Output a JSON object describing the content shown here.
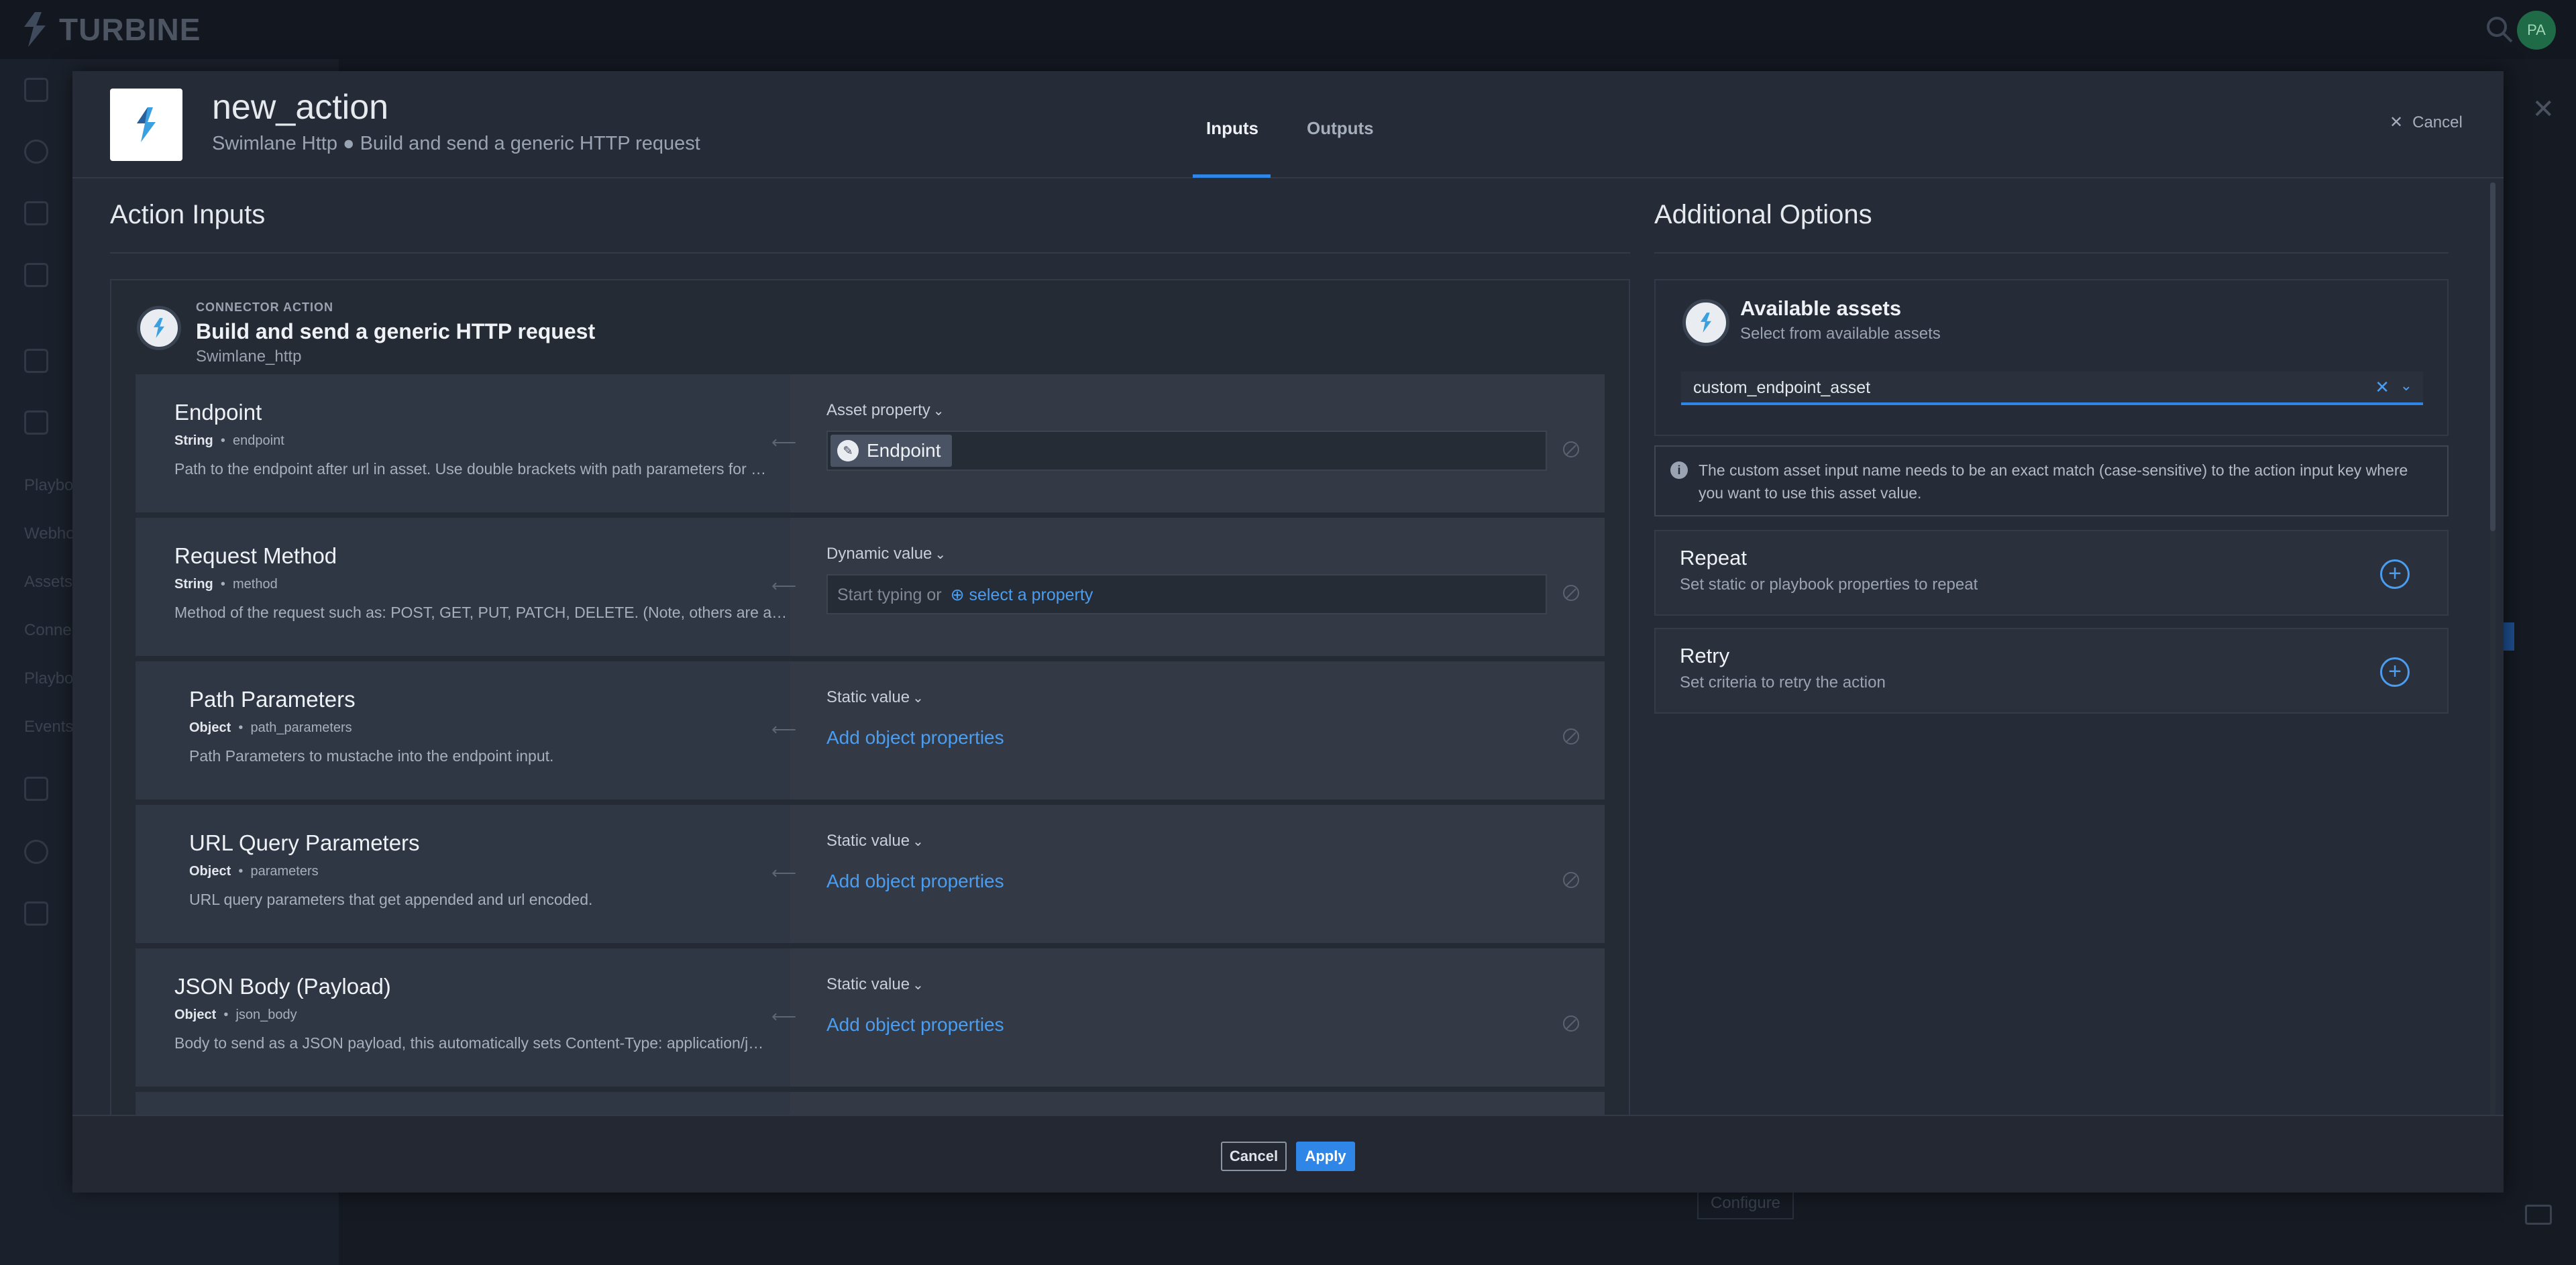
{
  "app": {
    "brand": "TURBINE",
    "avatar_initials": "PA"
  },
  "background_sidebar": {
    "items": [
      "Playbo",
      "Webho",
      "Assets",
      "Conne",
      "Playbo",
      "Events"
    ]
  },
  "background": {
    "configure_label": "Configure"
  },
  "modal": {
    "title": "new_action",
    "subtitle": "Swimlane Http ● Build and send a generic HTTP request",
    "tabs": [
      {
        "label": "Inputs"
      },
      {
        "label": "Outputs"
      }
    ],
    "active_tab": "Inputs",
    "header_cancel": "Cancel"
  },
  "action_inputs": {
    "title": "Action Inputs",
    "connector": {
      "kicker": "CONNECTOR ACTION",
      "name": "Build and send a generic HTTP request",
      "source": "Swimlane_http"
    },
    "rows": [
      {
        "name": "Endpoint",
        "type": "String",
        "key": "endpoint",
        "desc": "Path to the endpoint after url in asset. Use double brackets with path parameters for …",
        "mode": "Asset property",
        "chip": "Endpoint"
      },
      {
        "name": "Request Method",
        "type": "String",
        "key": "method",
        "desc": "Method of the request such as: POST, GET, PUT, PATCH, DELETE. (Note, others are ava…",
        "mode": "Dynamic value",
        "placeholder": "Start typing or",
        "select_property": "select a property"
      },
      {
        "name": "Path Parameters",
        "type": "Object",
        "key": "path_parameters",
        "desc": "Path Parameters to mustache into the endpoint input.",
        "mode": "Static value",
        "link": "Add object properties"
      },
      {
        "name": "URL Query Parameters",
        "type": "Object",
        "key": "parameters",
        "desc": "URL query parameters that get appended and url encoded.",
        "mode": "Static value",
        "link": "Add object properties"
      },
      {
        "name": "JSON Body (Payload)",
        "type": "Object",
        "key": "json_body",
        "desc": "Body to send as a JSON payload, this automatically sets Content-Type: application/j…",
        "mode": "Static value",
        "link": "Add object properties"
      }
    ]
  },
  "additional_options": {
    "title": "Additional Options",
    "assets": {
      "title": "Available assets",
      "subtitle": "Select from available assets",
      "selected": "custom_endpoint_asset"
    },
    "info": "The custom asset input name needs to be an exact match (case-sensitive) to the action input key where you want to use this asset value.",
    "repeat": {
      "title": "Repeat",
      "subtitle": "Set static or playbook properties to repeat"
    },
    "retry": {
      "title": "Retry",
      "subtitle": "Set criteria to retry the action"
    }
  },
  "footer": {
    "cancel": "Cancel",
    "apply": "Apply"
  },
  "colors": {
    "accent": "#2f86e6",
    "link": "#4b9df0",
    "modal_bg": "#262c37"
  },
  "icons": [
    "turbine-logo-icon",
    "search-icon",
    "close-icon",
    "bolt-icon",
    "info-icon",
    "plus-circle-icon",
    "chevron-down-icon",
    "arrow-left-icon",
    "disabled-icon",
    "keyboard-icon"
  ]
}
